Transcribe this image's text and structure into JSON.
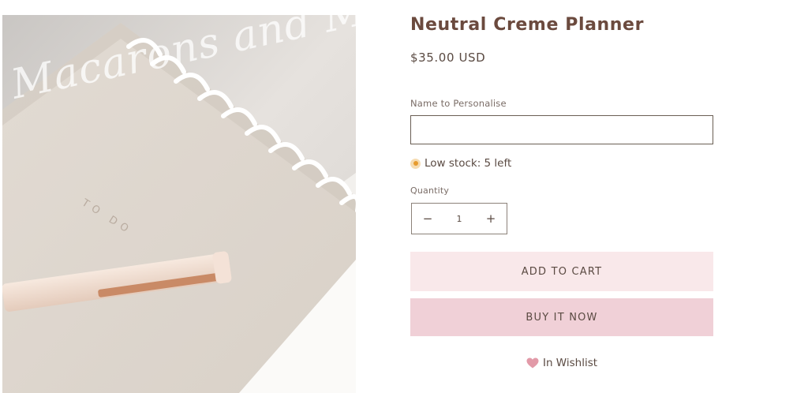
{
  "product": {
    "title": "Neutral Creme Planner",
    "price": "$35.00 USD",
    "image_watermark": "Macarons and Mimosas",
    "image_text": "TO DO"
  },
  "personalise": {
    "label": "Name to Personalise",
    "value": "",
    "placeholder": ""
  },
  "stock": {
    "text": "Low stock: 5 left",
    "dot_color": "#e79b2e"
  },
  "quantity": {
    "label": "Quantity",
    "value": "1",
    "decrease_symbol": "−",
    "increase_symbol": "+"
  },
  "buttons": {
    "add_to_cart": "ADD TO CART",
    "buy_now": "BUY IT NOW",
    "add_to_cart_color": "#f9e8ea",
    "buy_now_color": "#f0d0d7"
  },
  "wishlist": {
    "label": "In Wishlist",
    "icon": "heart-icon",
    "icon_color": "#e29aa8"
  }
}
